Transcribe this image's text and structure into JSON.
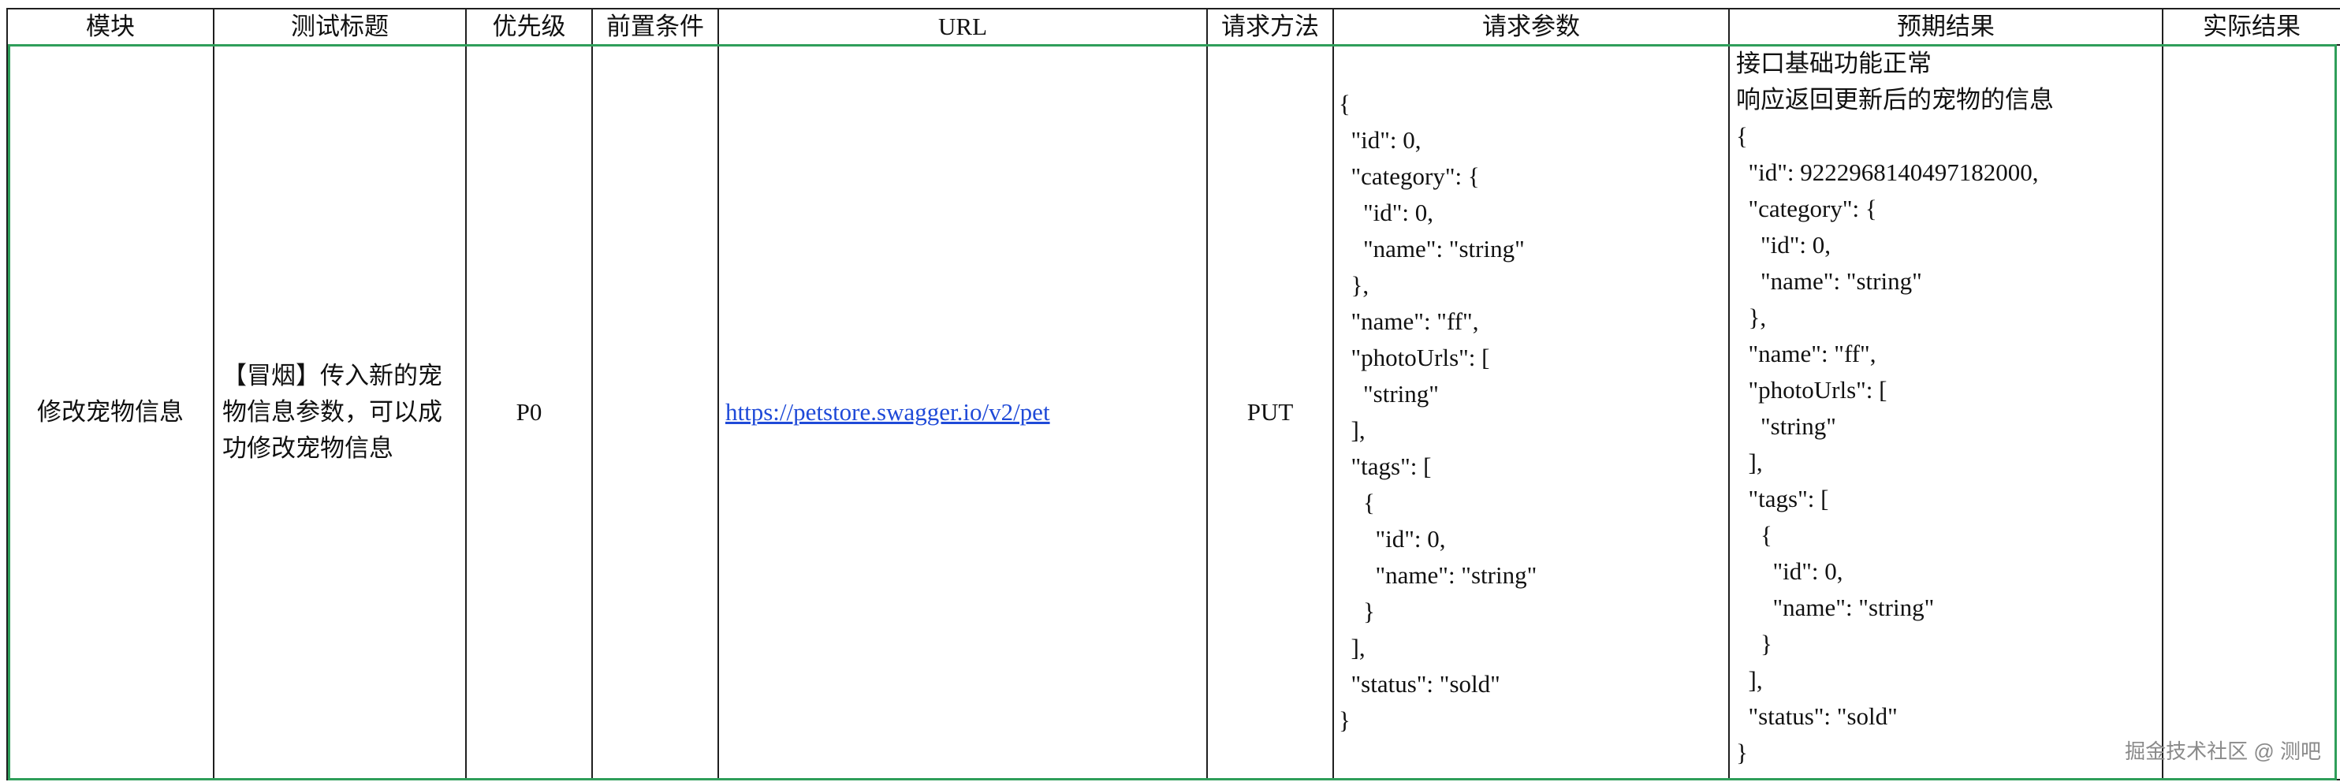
{
  "table": {
    "headers": [
      "模块",
      "测试标题",
      "优先级",
      "前置条件",
      "URL",
      "请求方法",
      "请求参数",
      "预期结果",
      "实际结果"
    ],
    "row": {
      "module": "修改宠物信息",
      "title": "【冒烟】传入新的宠物信息参数，可以成功修改宠物信息",
      "priority": "P0",
      "precondition": "",
      "url": "https://petstore.swagger.io/v2/pet",
      "method": "PUT",
      "request_params": "{\n  \"id\": 0,\n  \"category\": {\n    \"id\": 0,\n    \"name\": \"string\"\n  },\n  \"name\": \"ff\",\n  \"photoUrls\": [\n    \"string\"\n  ],\n  \"tags\": [\n    {\n      \"id\": 0,\n      \"name\": \"string\"\n    }\n  ],\n  \"status\": \"sold\"\n}",
      "expected_line1": "接口基础功能正常",
      "expected_line2": "响应返回更新后的宠物的信息",
      "expected_json": "{\n  \"id\": 9222968140497182000,\n  \"category\": {\n    \"id\": 0,\n    \"name\": \"string\"\n  },\n  \"name\": \"ff\",\n  \"photoUrls\": [\n    \"string\"\n  ],\n  \"tags\": [\n    {\n      \"id\": 0,\n      \"name\": \"string\"\n    }\n  ],\n  \"status\": \"sold\"\n}",
      "actual": ""
    }
  },
  "watermark": "掘金技术社区 @ 测吧",
  "colors": {
    "grid_line": "#1f1f1f",
    "selection_border": "#2f9e5a",
    "link": "#1f4ad8"
  }
}
